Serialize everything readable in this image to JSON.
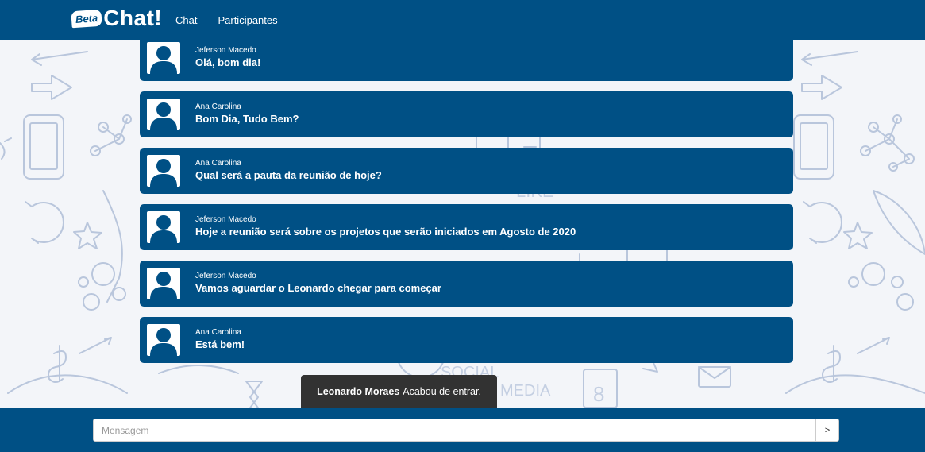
{
  "navbar": {
    "brand_badge": "Beta",
    "brand_text": "Chat!",
    "links": [
      "Chat",
      "Participantes"
    ]
  },
  "messages": [
    {
      "author": "Jeferson Macedo",
      "text": "Olá, bom dia!"
    },
    {
      "author": "Ana Carolina",
      "text": "Bom Dia, Tudo Bem?"
    },
    {
      "author": "Ana Carolina",
      "text": "Qual será a pauta da reunião de hoje?"
    },
    {
      "author": "Jeferson Macedo",
      "text": "Hoje a reunião será sobre os projetos que serão iniciados em Agosto de 2020"
    },
    {
      "author": "Jeferson Macedo",
      "text": "Vamos aguardar o Leonardo chegar para começar"
    },
    {
      "author": "Ana Carolina",
      "text": "Está bem!"
    }
  ],
  "toast": {
    "name": "Leonardo Moraes",
    "text": "Acabou de entrar."
  },
  "composer": {
    "placeholder": "Mensagem",
    "send_label": ">"
  },
  "colors": {
    "primary": "#005085",
    "toast_bg": "#323232"
  },
  "background_doodles": [
    "SOCIAL",
    "MEDIA",
    "LIKE",
    "8"
  ]
}
